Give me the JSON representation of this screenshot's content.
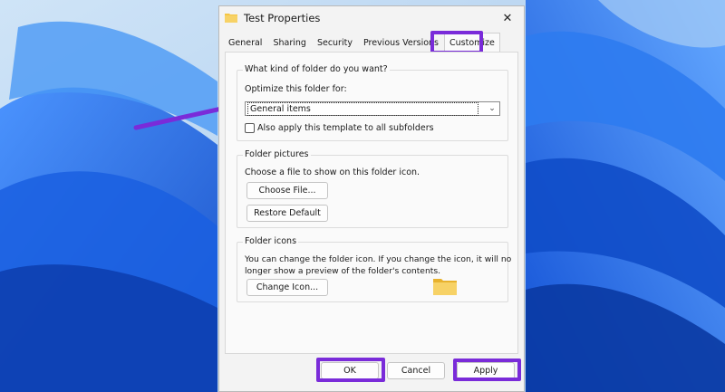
{
  "window": {
    "title": "Test Properties",
    "close_glyph": "✕"
  },
  "tabs": [
    {
      "label": "General"
    },
    {
      "label": "Sharing"
    },
    {
      "label": "Security"
    },
    {
      "label": "Previous Versions"
    },
    {
      "label": "Customize",
      "active": true
    }
  ],
  "customize": {
    "folder_type_group": "What kind of folder do you want?",
    "optimize_label": "Optimize this folder for:",
    "optimize_value": "General items",
    "apply_subfolders_label": "Also apply this template to all subfolders",
    "apply_subfolders_checked": false,
    "pictures_group": "Folder pictures",
    "pictures_desc": "Choose a file to show on this folder icon.",
    "choose_file_button": "Choose File...",
    "restore_default_button": "Restore Default",
    "icons_group": "Folder icons",
    "icons_desc_line1": "You can change the folder icon. If you change the icon, it will no",
    "icons_desc_line2": "longer show a preview of the folder's contents.",
    "change_icon_button": "Change Icon..."
  },
  "footer": {
    "ok_label": "OK",
    "cancel_label": "Cancel",
    "apply_label": "Apply"
  },
  "colors": {
    "highlight": "#7a2bd9",
    "folder": "#f5c542",
    "desktop_blue": "#1e73e6"
  },
  "icons": [
    "folder-icon",
    "close-icon",
    "chevron-down-icon",
    "annotation-arrow"
  ]
}
